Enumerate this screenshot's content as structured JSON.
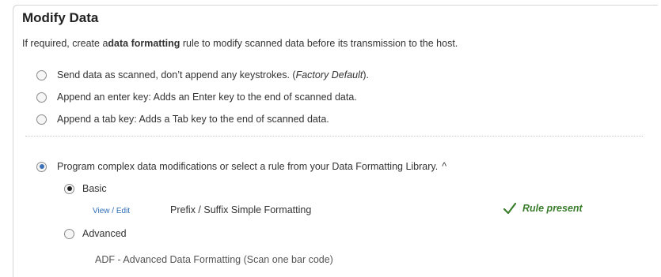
{
  "section": {
    "title": "Modify Data",
    "intro_prefix": "If required, create a",
    "intro_bold": "data formatting",
    "intro_suffix": " rule to modify scanned data before its transmission to the host."
  },
  "options": {
    "send_as_scanned": {
      "label": "Send data as scanned, don’t append any keystrokes. (",
      "note": "Factory Default",
      "suffix": ")."
    },
    "append_enter": {
      "label": "Append an enter key: Adds an Enter key to the end of scanned data."
    },
    "append_tab": {
      "label": "Append a tab key: Adds a Tab key to the end of scanned data."
    },
    "program_complex": {
      "label": "Program complex data modifications or select a rule from your Data Formatting Library.",
      "toggle": "^"
    }
  },
  "basic": {
    "label": "Basic",
    "view_label": "View",
    "separator": " / ",
    "edit_label": "Edit",
    "rule_name": "Prefix / Suffix Simple Formatting",
    "rule_status": "Rule present",
    "status_icon": "check-icon",
    "status_color": "#3a7d2c"
  },
  "advanced": {
    "label": "Advanced",
    "description": "ADF - Advanced Data Formatting (Scan one bar code)"
  },
  "colors": {
    "link": "#2f6fb5",
    "radio_selected": "#3b6fb6"
  }
}
